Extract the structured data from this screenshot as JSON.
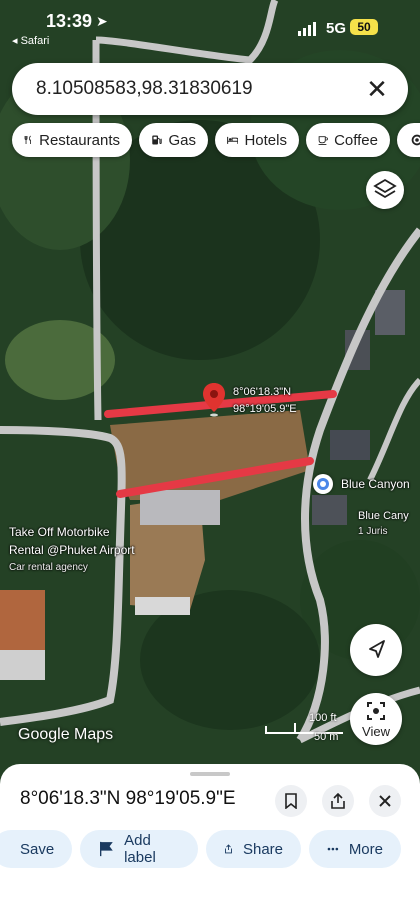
{
  "status_bar": {
    "time": "13:39",
    "back_app": "Safari",
    "network": "5G",
    "battery": "50"
  },
  "search": {
    "value": "8.10508583,98.31830619"
  },
  "chips": [
    {
      "label": "Restaurants",
      "icon": "fork-knife-icon"
    },
    {
      "label": "Gas",
      "icon": "gas-pump-icon"
    },
    {
      "label": "Hotels",
      "icon": "bed-icon"
    },
    {
      "label": "Coffee",
      "icon": "coffee-cup-icon"
    }
  ],
  "map": {
    "pin_label_line1": "8°06'18.3\"N",
    "pin_label_line2": "98°19'05.9\"E",
    "place_blue_canyon": "Blue Canyon",
    "place_blue_canyon_2_line1": "Blue Cany",
    "place_blue_canyon_2_line2": "1 Juris",
    "place_takeoff_line1": "Take Off Motorbike",
    "place_takeoff_line2": "Rental @Phuket Airport",
    "place_takeoff_category": "Car rental agency",
    "attribution": "Google Maps",
    "scale_imperial": "100 ft",
    "scale_metric": "50 m",
    "view_button_label": "View"
  },
  "sheet": {
    "title": "8°06'18.3\"N 98°19'05.9\"E",
    "actions": [
      {
        "label": "Save",
        "icon": "bookmark-icon"
      },
      {
        "label": "Add label",
        "icon": "flag-icon"
      },
      {
        "label": "Share",
        "icon": "share-icon"
      },
      {
        "label": "More",
        "icon": "more-dots-icon"
      }
    ]
  },
  "colors": {
    "accent": "#e53945",
    "sheet_button_bg": "#e6f1fb",
    "pin": "#e0332f",
    "place_marker": "#4a86e8"
  }
}
